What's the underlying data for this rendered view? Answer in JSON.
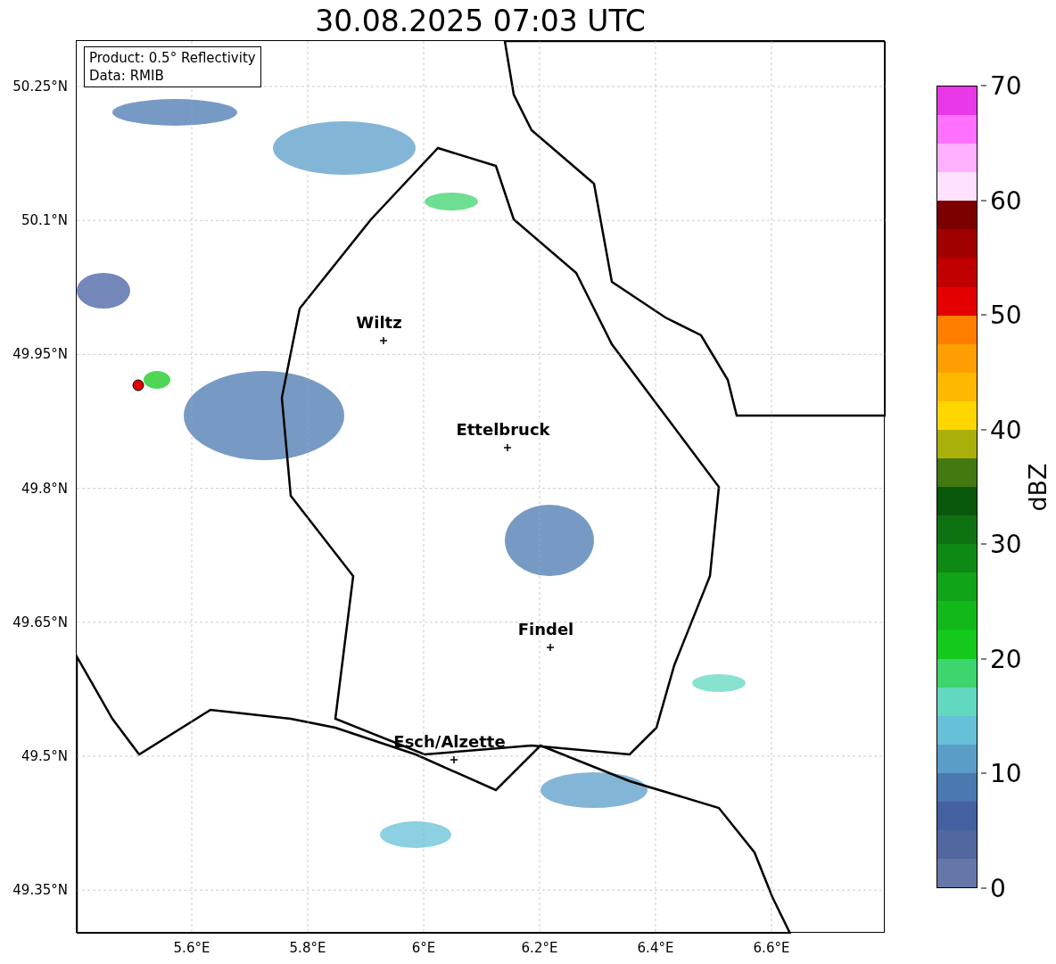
{
  "title": "30.08.2025 07:03 UTC",
  "info_box": [
    "Product: 0.5° Reflectivity",
    "Data: RMIB"
  ],
  "y_ticks": [
    "50.25°N",
    "50.1°N",
    "49.95°N",
    "49.8°N",
    "49.65°N",
    "49.5°N",
    "49.35°N"
  ],
  "x_ticks": [
    "5.6°E",
    "5.8°E",
    "6°E",
    "6.2°E",
    "6.4°E",
    "6.6°E"
  ],
  "cities": [
    {
      "name": "Wiltz"
    },
    {
      "name": "Ettelbruck"
    },
    {
      "name": "Findel"
    },
    {
      "name": "Esch/Alzette"
    }
  ],
  "colorbar": {
    "label": "dBZ",
    "ticks": [
      "70",
      "60",
      "50",
      "40",
      "30",
      "20",
      "10",
      "0"
    ],
    "segments": [
      {
        "color": "#e838e8"
      },
      {
        "color": "#ff70ff"
      },
      {
        "color": "#ffb0ff"
      },
      {
        "color": "#ffe0ff"
      },
      {
        "color": "#7c0000"
      },
      {
        "color": "#a00000"
      },
      {
        "color": "#c00000"
      },
      {
        "color": "#e40000"
      },
      {
        "color": "#ff7e00"
      },
      {
        "color": "#ff9e00"
      },
      {
        "color": "#ffb800"
      },
      {
        "color": "#ffd600"
      },
      {
        "color": "#aab00a"
      },
      {
        "color": "#447810"
      },
      {
        "color": "#0a580c"
      },
      {
        "color": "#0e7212"
      },
      {
        "color": "#0e8a14"
      },
      {
        "color": "#10a418"
      },
      {
        "color": "#12b81a"
      },
      {
        "color": "#14c81c"
      },
      {
        "color": "#3ed46e"
      },
      {
        "color": "#62d8c0"
      },
      {
        "color": "#66c0d8"
      },
      {
        "color": "#5a9ec8"
      },
      {
        "color": "#4a78b0"
      },
      {
        "color": "#4460a0"
      },
      {
        "color": "#52679f"
      },
      {
        "color": "#6577a8"
      }
    ]
  }
}
